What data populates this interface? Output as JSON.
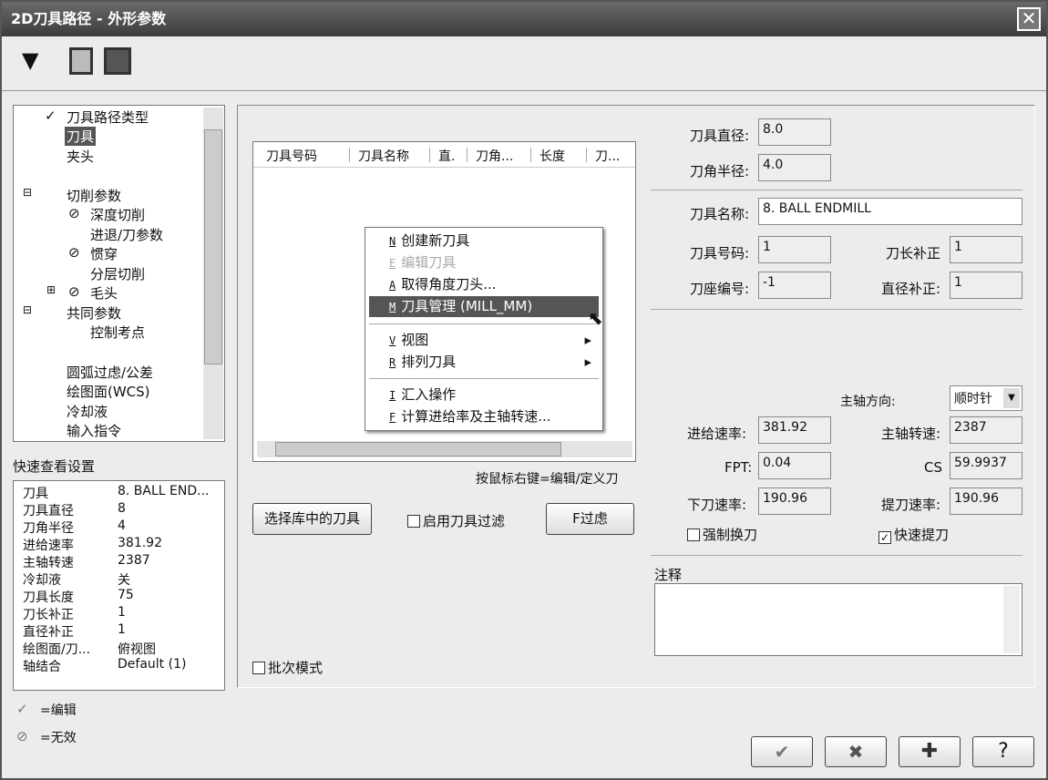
{
  "title": "2D刀具路径 - 外形参数",
  "toolbar": {
    "icons": [
      "tool-icon",
      "save-icon",
      "save-as-icon"
    ]
  },
  "tree": {
    "items": [
      "刀具路径类型",
      "刀具",
      "夹头",
      "切削参数",
      "深度切削",
      "进退/刀参数",
      "惯穿",
      "分层切削",
      "毛头",
      "共同参数",
      "控制考点",
      "圆弧过虑/公差",
      "绘图面(WCS)",
      "冷却液",
      "输入指令"
    ],
    "selected": "刀具"
  },
  "quick": {
    "title": "快速查看设置",
    "rows": [
      [
        "刀具",
        "8. BALL END..."
      ],
      [
        "刀具直径",
        "8"
      ],
      [
        "刀角半径",
        "4"
      ],
      [
        "进给速率",
        "381.92"
      ],
      [
        "主轴转速",
        "2387"
      ],
      [
        "冷却液",
        "关"
      ],
      [
        "刀具长度",
        "75"
      ],
      [
        "刀长补正",
        "1"
      ],
      [
        "直径补正",
        "1"
      ],
      [
        "绘图面/刀...",
        "俯视图"
      ],
      [
        "轴结合",
        "Default (1)"
      ]
    ]
  },
  "legend": {
    "edit": "=编辑",
    "disabled": "=无效"
  },
  "toollist": {
    "columns": [
      "刀具号码",
      "刀具名称",
      "直.",
      "刀角...",
      "长度",
      "刀..."
    ],
    "hint": "按鼠标右键=编辑/定义刀"
  },
  "menu": [
    {
      "key": "N",
      "label": "创建新刀具"
    },
    {
      "key": "E",
      "label": "编辑刀具",
      "disabled": true
    },
    {
      "key": "A",
      "label": "取得角度刀头..."
    },
    {
      "key": "M",
      "label": "刀具管理  (MILL_MM)",
      "highlight": true
    },
    {
      "key": "V",
      "label": "视图",
      "sub": true
    },
    {
      "key": "R",
      "label": "排列刀具",
      "sub": true
    },
    {
      "key": "I",
      "label": "汇入操作"
    },
    {
      "key": "F",
      "label": "计算进给率及主轴转速..."
    }
  ],
  "buttons": {
    "select_lib": "选择库中的刀具",
    "filter_enable": "启用刀具过滤",
    "filter": "F过虑",
    "batch": "批次模式"
  },
  "params": {
    "dia_label": "刀具直径:",
    "dia": "8.0",
    "rad_label": "刀角半径:",
    "rad": "4.0",
    "name_label": "刀具名称:",
    "name": "8. BALL ENDMILL",
    "num_label": "刀具号码:",
    "num": "1",
    "lencomp_label": "刀长补正",
    "lencomp": "1",
    "holder_label": "刀座编号:",
    "holder": "-1",
    "diacomp_label": "直径补正:",
    "diacomp": "1",
    "spindir_label": "主轴方向:",
    "spindir": "顺时针",
    "feed_label": "进给速率:",
    "feed": "381.92",
    "speed_label": "主轴转速:",
    "speed": "2387",
    "fpt_label": "FPT:",
    "fpt": "0.04",
    "cs_label": "CS",
    "cs": "59.9937",
    "plunge_label": "下刀速率:",
    "plunge": "190.96",
    "retract_label": "提刀速率:",
    "retract": "190.96",
    "force_change": "强制换刀",
    "rapid_retract": "快速提刀",
    "comment_label": "注释"
  },
  "footer": {
    "ok": "✔",
    "cancel": "✖",
    "add": "✚",
    "help": "?"
  }
}
